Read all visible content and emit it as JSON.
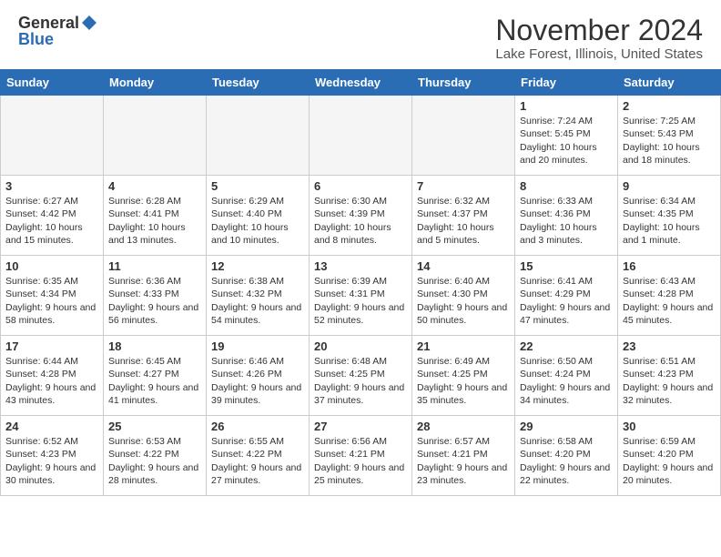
{
  "header": {
    "logo_general": "General",
    "logo_blue": "Blue",
    "title": "November 2024",
    "subtitle": "Lake Forest, Illinois, United States"
  },
  "calendar": {
    "days_of_week": [
      "Sunday",
      "Monday",
      "Tuesday",
      "Wednesday",
      "Thursday",
      "Friday",
      "Saturday"
    ],
    "weeks": [
      [
        {
          "day": "",
          "info": ""
        },
        {
          "day": "",
          "info": ""
        },
        {
          "day": "",
          "info": ""
        },
        {
          "day": "",
          "info": ""
        },
        {
          "day": "",
          "info": ""
        },
        {
          "day": "1",
          "info": "Sunrise: 7:24 AM\nSunset: 5:45 PM\nDaylight: 10 hours and 20 minutes."
        },
        {
          "day": "2",
          "info": "Sunrise: 7:25 AM\nSunset: 5:43 PM\nDaylight: 10 hours and 18 minutes."
        }
      ],
      [
        {
          "day": "3",
          "info": "Sunrise: 6:27 AM\nSunset: 4:42 PM\nDaylight: 10 hours and 15 minutes."
        },
        {
          "day": "4",
          "info": "Sunrise: 6:28 AM\nSunset: 4:41 PM\nDaylight: 10 hours and 13 minutes."
        },
        {
          "day": "5",
          "info": "Sunrise: 6:29 AM\nSunset: 4:40 PM\nDaylight: 10 hours and 10 minutes."
        },
        {
          "day": "6",
          "info": "Sunrise: 6:30 AM\nSunset: 4:39 PM\nDaylight: 10 hours and 8 minutes."
        },
        {
          "day": "7",
          "info": "Sunrise: 6:32 AM\nSunset: 4:37 PM\nDaylight: 10 hours and 5 minutes."
        },
        {
          "day": "8",
          "info": "Sunrise: 6:33 AM\nSunset: 4:36 PM\nDaylight: 10 hours and 3 minutes."
        },
        {
          "day": "9",
          "info": "Sunrise: 6:34 AM\nSunset: 4:35 PM\nDaylight: 10 hours and 1 minute."
        }
      ],
      [
        {
          "day": "10",
          "info": "Sunrise: 6:35 AM\nSunset: 4:34 PM\nDaylight: 9 hours and 58 minutes."
        },
        {
          "day": "11",
          "info": "Sunrise: 6:36 AM\nSunset: 4:33 PM\nDaylight: 9 hours and 56 minutes."
        },
        {
          "day": "12",
          "info": "Sunrise: 6:38 AM\nSunset: 4:32 PM\nDaylight: 9 hours and 54 minutes."
        },
        {
          "day": "13",
          "info": "Sunrise: 6:39 AM\nSunset: 4:31 PM\nDaylight: 9 hours and 52 minutes."
        },
        {
          "day": "14",
          "info": "Sunrise: 6:40 AM\nSunset: 4:30 PM\nDaylight: 9 hours and 50 minutes."
        },
        {
          "day": "15",
          "info": "Sunrise: 6:41 AM\nSunset: 4:29 PM\nDaylight: 9 hours and 47 minutes."
        },
        {
          "day": "16",
          "info": "Sunrise: 6:43 AM\nSunset: 4:28 PM\nDaylight: 9 hours and 45 minutes."
        }
      ],
      [
        {
          "day": "17",
          "info": "Sunrise: 6:44 AM\nSunset: 4:28 PM\nDaylight: 9 hours and 43 minutes."
        },
        {
          "day": "18",
          "info": "Sunrise: 6:45 AM\nSunset: 4:27 PM\nDaylight: 9 hours and 41 minutes."
        },
        {
          "day": "19",
          "info": "Sunrise: 6:46 AM\nSunset: 4:26 PM\nDaylight: 9 hours and 39 minutes."
        },
        {
          "day": "20",
          "info": "Sunrise: 6:48 AM\nSunset: 4:25 PM\nDaylight: 9 hours and 37 minutes."
        },
        {
          "day": "21",
          "info": "Sunrise: 6:49 AM\nSunset: 4:25 PM\nDaylight: 9 hours and 35 minutes."
        },
        {
          "day": "22",
          "info": "Sunrise: 6:50 AM\nSunset: 4:24 PM\nDaylight: 9 hours and 34 minutes."
        },
        {
          "day": "23",
          "info": "Sunrise: 6:51 AM\nSunset: 4:23 PM\nDaylight: 9 hours and 32 minutes."
        }
      ],
      [
        {
          "day": "24",
          "info": "Sunrise: 6:52 AM\nSunset: 4:23 PM\nDaylight: 9 hours and 30 minutes."
        },
        {
          "day": "25",
          "info": "Sunrise: 6:53 AM\nSunset: 4:22 PM\nDaylight: 9 hours and 28 minutes."
        },
        {
          "day": "26",
          "info": "Sunrise: 6:55 AM\nSunset: 4:22 PM\nDaylight: 9 hours and 27 minutes."
        },
        {
          "day": "27",
          "info": "Sunrise: 6:56 AM\nSunset: 4:21 PM\nDaylight: 9 hours and 25 minutes."
        },
        {
          "day": "28",
          "info": "Sunrise: 6:57 AM\nSunset: 4:21 PM\nDaylight: 9 hours and 23 minutes."
        },
        {
          "day": "29",
          "info": "Sunrise: 6:58 AM\nSunset: 4:20 PM\nDaylight: 9 hours and 22 minutes."
        },
        {
          "day": "30",
          "info": "Sunrise: 6:59 AM\nSunset: 4:20 PM\nDaylight: 9 hours and 20 minutes."
        }
      ]
    ]
  }
}
